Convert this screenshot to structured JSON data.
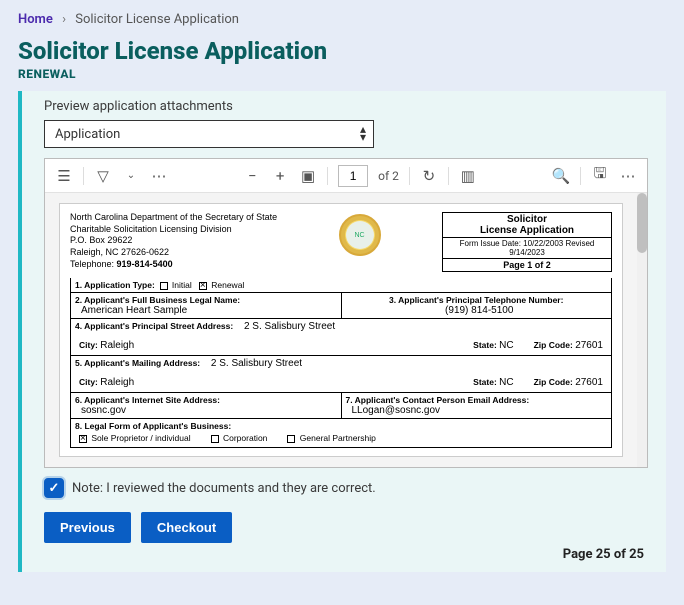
{
  "breadcrumb": {
    "home": "Home",
    "current": "Solicitor License Application"
  },
  "header": {
    "title": "Solicitor License Application",
    "subtitle": "RENEWAL"
  },
  "attachments": {
    "label": "Preview application attachments",
    "selected": "Application"
  },
  "viewer": {
    "page_current": "1",
    "page_of": "of 2"
  },
  "doc": {
    "dept_line1": "North Carolina Department of the Secretary of State",
    "dept_line2": "Charitable Solicitation Licensing Division",
    "dept_line3": "P.O. Box 29622",
    "dept_line4": "Raleigh, NC  27626-0622",
    "phone_label": "Telephone:  ",
    "phone": "919-814-5400",
    "title1": "Solicitor",
    "title2": "License Application",
    "issue": "Form Issue Date: 10/22/2003 Revised  9/14/2023",
    "pageline": "Page 1 of 2",
    "f1_label": "1. Application Type:",
    "f1_opt1": "Initial",
    "f1_opt2": "Renewal",
    "f2_label": "2. Applicant's Full Business Legal Name:",
    "f2_val": "American Heart Sample",
    "f3_label": "3. Applicant's Principal Telephone Number:",
    "f3_val": "(919) 814-5100",
    "f4_label": "4. Applicant's Principal Street Address:",
    "f4_street": "2 S. Salisbury Street",
    "city_label": "City:",
    "state_label": "State:",
    "zip_label": "Zip Code:",
    "f4_city": "Raleigh",
    "f4_state": "NC",
    "f4_zip": "27601",
    "f5_label": "5. Applicant's Mailing Address:",
    "f5_street": "2 S. Salisbury Street",
    "f5_city": "Raleigh",
    "f5_state": "NC",
    "f5_zip": "27601",
    "f6_label": "6. Applicant's Internet Site Address:",
    "f6_val": "sosnc.gov",
    "f7_label": "7. Applicant's  Contact Person Email Address:",
    "f7_val": "LLogan@sosnc.gov",
    "f8_label": "8. Legal Form of Applicant's Business:",
    "f8_opt1": "Sole Proprietor / individual",
    "f8_opt2": "Corporation",
    "f8_opt3": "General Partnership"
  },
  "confirm": {
    "text": "Note: I reviewed the documents and they are correct."
  },
  "buttons": {
    "previous": "Previous",
    "checkout": "Checkout"
  },
  "footer": {
    "page": "Page 25 of 25"
  }
}
